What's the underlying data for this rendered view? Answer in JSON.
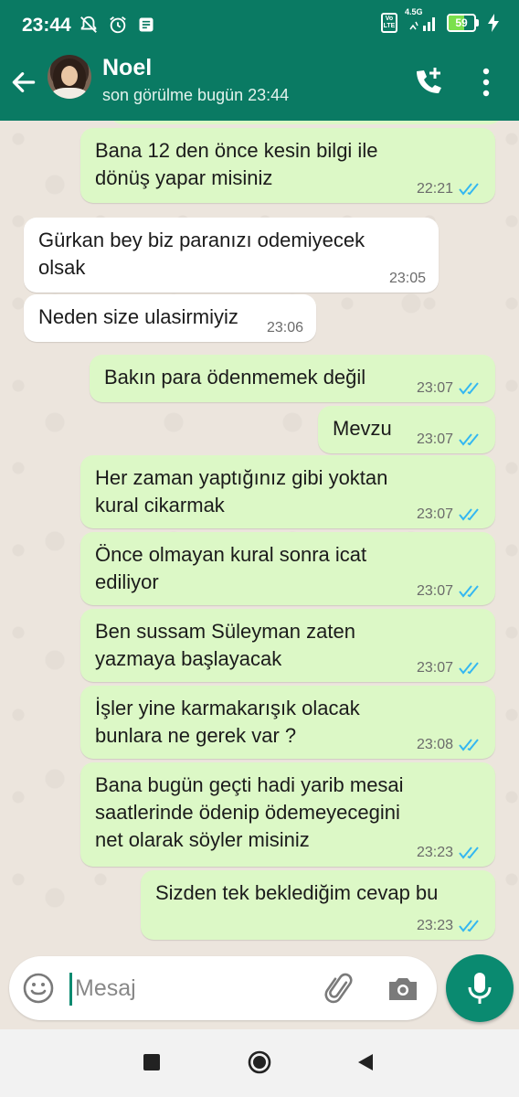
{
  "status_bar": {
    "time": "23:44",
    "network": "4.5G",
    "volte": "Vo LTE",
    "battery": "59",
    "battery_level": 0.59
  },
  "header": {
    "contact_name": "Noel",
    "last_seen": "son görülme bugün 23:44"
  },
  "messages": [
    {
      "dir": "out",
      "lines": [
        "Bana 12 den önce kesin bilgi ile",
        "dönüş yapar misiniz"
      ],
      "time": "22:21",
      "read": true
    },
    {
      "dir": "in",
      "lines": [
        "Gürkan bey biz paranızı odemiyecek",
        "olsak"
      ],
      "time": "23:05"
    },
    {
      "dir": "in",
      "lines": [
        "Neden size ulasirmiyiz"
      ],
      "time": "23:06"
    },
    {
      "dir": "out",
      "lines": [
        "Bakın para ödenmemek değil"
      ],
      "time": "23:07",
      "read": true
    },
    {
      "dir": "out",
      "lines": [
        "Mevzu"
      ],
      "time": "23:07",
      "read": true
    },
    {
      "dir": "out",
      "lines": [
        "Her zaman yaptığınız gibi yoktan",
        "kural cikarmak"
      ],
      "time": "23:07",
      "read": true
    },
    {
      "dir": "out",
      "lines": [
        "Önce olmayan kural sonra icat",
        "ediliyor"
      ],
      "time": "23:07",
      "read": true
    },
    {
      "dir": "out",
      "lines": [
        "Ben sussam Süleyman zaten",
        "yazmaya başlayacak"
      ],
      "time": "23:07",
      "read": true
    },
    {
      "dir": "out",
      "lines": [
        "İşler yine karmakarışık olacak",
        "bunlara ne gerek var ?"
      ],
      "time": "23:08",
      "read": true
    },
    {
      "dir": "out",
      "lines": [
        "Bana bugün geçti hadi yarib mesai",
        "saatlerinde ödenip ödemeyecegini",
        "net olarak söyler misiniz"
      ],
      "time": "23:23",
      "read": true
    },
    {
      "dir": "out",
      "lines": [
        "Sizden tek beklediğim cevap bu"
      ],
      "time": "23:23",
      "read": true
    }
  ],
  "composer": {
    "placeholder": "Mesaj"
  },
  "colors": {
    "header": "#0a7a63",
    "outgoing_bubble": "#dcf8c6",
    "incoming_bubble": "#ffffff",
    "read_ticks": "#34b7f1",
    "mic_button": "#0a8a70"
  },
  "icons": [
    "back-arrow-icon",
    "add-call-icon",
    "more-vert-icon",
    "emoji-icon",
    "attach-icon",
    "camera-icon",
    "mic-icon",
    "double-check-icon"
  ]
}
